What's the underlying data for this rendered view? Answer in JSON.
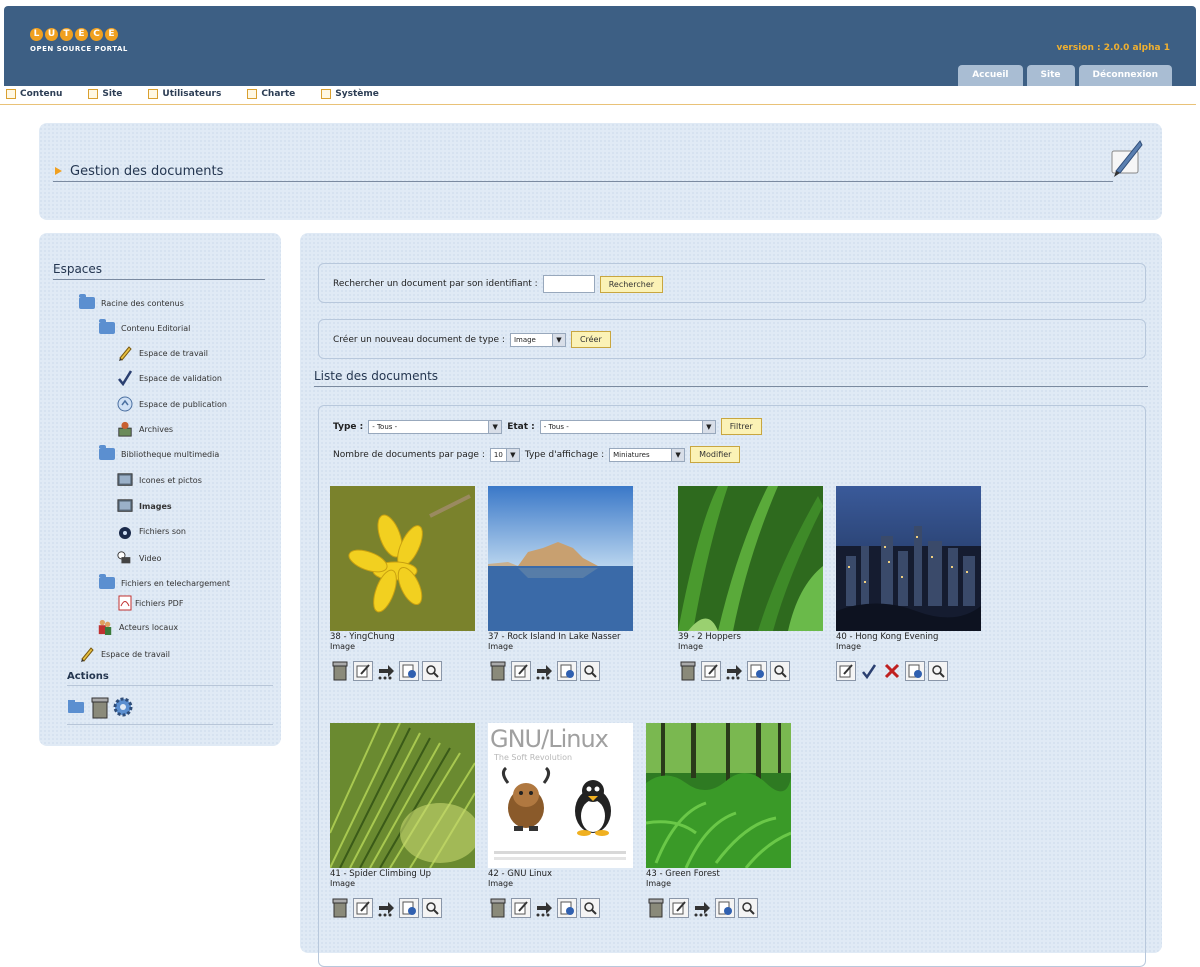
{
  "header": {
    "logo_letters": [
      "L",
      "U",
      "T",
      "E",
      "C",
      "E"
    ],
    "logo_sub": "OPEN SOURCE PORTAL",
    "version": "version : 2.0.0 alpha 1",
    "tabs": [
      "Accueil",
      "Site",
      "Déconnexion"
    ]
  },
  "menubar": {
    "items": [
      "Contenu",
      "Site",
      "Utilisateurs",
      "Charte",
      "Système"
    ]
  },
  "page": {
    "title": "Gestion des documents"
  },
  "sidebar": {
    "heading": "Espaces",
    "tree": [
      {
        "label": "Racine des contenus",
        "icon": "folder-icon"
      },
      {
        "label": "Contenu Editorial",
        "icon": "folder-icon"
      },
      {
        "label": "Espace de travail",
        "icon": "pencil-icon"
      },
      {
        "label": "Espace de validation",
        "icon": "checkmark-icon"
      },
      {
        "label": "Espace de publication",
        "icon": "publish-icon"
      },
      {
        "label": "Archives",
        "icon": "archive-icon"
      },
      {
        "label": "Bibliotheque multimedia",
        "icon": "folder-icon"
      },
      {
        "label": "Icones et pictos",
        "icon": "picture-icon"
      },
      {
        "label": "Images",
        "icon": "picture-icon"
      },
      {
        "label": "Fichiers son",
        "icon": "sound-icon"
      },
      {
        "label": "Video",
        "icon": "video-icon"
      },
      {
        "label": "Fichiers en telechargement",
        "icon": "folder-icon"
      },
      {
        "label": "Fichiers PDF",
        "icon": "pdf-icon"
      },
      {
        "label": "Acteurs locaux",
        "icon": "people-icon"
      },
      {
        "label": "Espace de travail",
        "icon": "pencil-icon"
      }
    ],
    "actions_heading": "Actions"
  },
  "main": {
    "search_label": "Rechercher un document par son identifiant :",
    "search_value": "",
    "search_button": "Rechercher",
    "create_label": "Créer un nouveau document de type :",
    "create_type": "Image",
    "create_button": "Créer",
    "list_title": "Liste des documents",
    "filter": {
      "type_label": "Type :",
      "type_value": "- Tous -",
      "state_label": "Etat :",
      "state_value": "- Tous -",
      "filter_button": "Filtrer",
      "per_page_label": "Nombre de documents par page :",
      "per_page_value": "10",
      "display_label": "Type d'affichage :",
      "display_value": "Miniatures",
      "modify_button": "Modifier"
    },
    "documents": [
      {
        "caption": "38 - YingChung",
        "type": "Image",
        "image": "yellow-flower"
      },
      {
        "caption": "37 - Rock Island In Lake Nasser",
        "type": "Image",
        "image": "rock-island"
      },
      {
        "caption": "39 - 2 Hoppers",
        "type": "Image",
        "image": "grass-hoppers"
      },
      {
        "caption": "40 - Hong Kong Evening",
        "type": "Image",
        "image": "hong-kong"
      },
      {
        "caption": "41 - Spider Climbing Up",
        "type": "Image",
        "image": "pine-needles"
      },
      {
        "caption": "42 - GNU Linux",
        "type": "Image",
        "image": "gnu-linux",
        "image_text": "GNU/Linux",
        "image_subtext": "The Soft Revolution"
      },
      {
        "caption": "43 - Green Forest",
        "type": "Image",
        "image": "green-forest"
      }
    ]
  },
  "colors": {
    "header_bg": "#3d5f84",
    "tab_bg": "#a9bdd3",
    "version_text": "#f0b030",
    "panel_bg": "#e0eaf5",
    "button_bg": "#fbf2b6"
  }
}
